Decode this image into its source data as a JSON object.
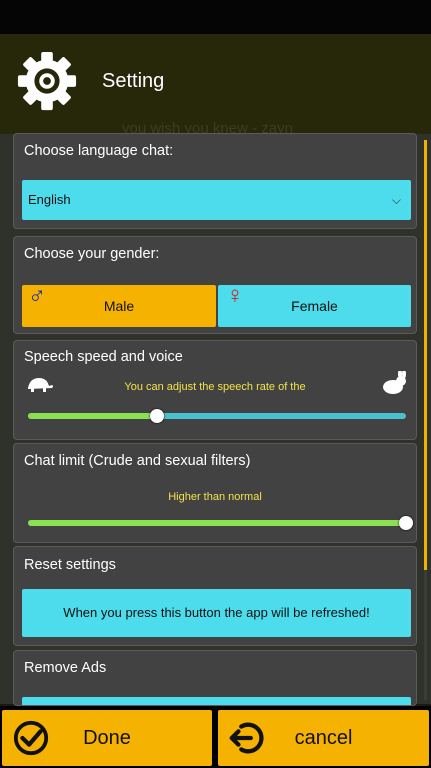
{
  "header": {
    "title": "Setting",
    "background_text": "you wish you knew - zayn"
  },
  "language": {
    "label": "Choose language chat:",
    "selected": "English"
  },
  "gender": {
    "label": "Choose your gender:",
    "male": "Male",
    "female": "Female",
    "male_symbol": "♂",
    "female_symbol": "♀",
    "selected": "Male"
  },
  "speech": {
    "label": "Speech speed and voice",
    "hint": "You can adjust the speech rate of the",
    "level": 0.34
  },
  "chat_limit": {
    "label": "Chat limit (Crude and sexual filters)",
    "hint": "Higher than normal",
    "level": 1.0
  },
  "reset": {
    "label": "Reset settings",
    "button": "When you press this button the app will be refreshed!"
  },
  "ads": {
    "label": "Remove Ads"
  },
  "actions": {
    "done": "Done",
    "cancel": "cancel"
  },
  "colors": {
    "accent": "#f5b200",
    "cyan": "#4ddcec",
    "slider_fill": "#8ae050",
    "hint_text": "#f2e44a"
  }
}
